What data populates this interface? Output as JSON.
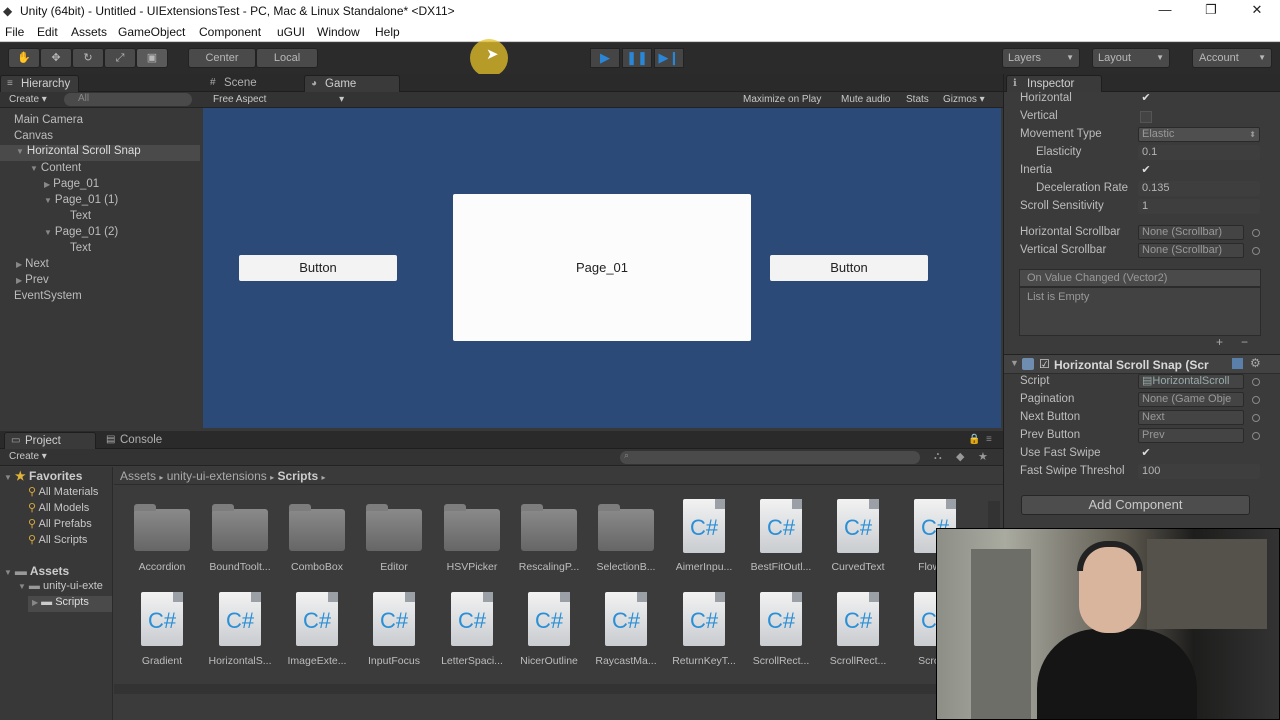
{
  "window": {
    "title": "Unity (64bit) - Untitled - UIExtensionsTest - PC, Mac & Linux Standalone* <DX11>"
  },
  "menu": [
    "File",
    "Edit",
    "Assets",
    "GameObject",
    "Component",
    "uGUI",
    "Window",
    "Help"
  ],
  "toolbar": {
    "pivot": "Center",
    "space": "Local",
    "layers": "Layers",
    "layout": "Layout",
    "account": "Account"
  },
  "hierarchy": {
    "tab": "Hierarchy",
    "create": "Create",
    "search_placeholder": "All",
    "items": [
      {
        "label": "Main Camera"
      },
      {
        "label": "Canvas"
      },
      {
        "label": "Horizontal Scroll Snap"
      },
      {
        "label": "Content"
      },
      {
        "label": "Page_01"
      },
      {
        "label": "Page_01 (1)"
      },
      {
        "label": "Text"
      },
      {
        "label": "Page_01 (2)"
      },
      {
        "label": "Text"
      },
      {
        "label": "Next"
      },
      {
        "label": "Prev"
      },
      {
        "label": "EventSystem"
      }
    ]
  },
  "scene": {
    "tab_scene": "Scene",
    "tab_game": "Game",
    "aspect": "Free Aspect",
    "options": [
      "Maximize on Play",
      "Mute audio",
      "Stats",
      "Gizmos"
    ],
    "left_button": "Button",
    "page_label": "Page_01",
    "right_button": "Button"
  },
  "inspector": {
    "tab": "Inspector",
    "scroll_rect": {
      "horizontal_label": "Horizontal",
      "vertical_label": "Vertical",
      "movement_label": "Movement Type",
      "movement_value": "Elastic",
      "elasticity_label": "Elasticity",
      "elasticity_value": "0.1",
      "inertia_label": "Inertia",
      "decel_label": "Deceleration Rate",
      "decel_value": "0.135",
      "sensitivity_label": "Scroll Sensitivity",
      "sensitivity_value": "1",
      "hscroll_label": "Horizontal Scrollbar",
      "hscroll_value": "None (Scrollbar)",
      "vscroll_label": "Vertical Scrollbar",
      "vscroll_value": "None (Scrollbar)",
      "event_label": "On Value Changed (Vector2)",
      "event_empty": "List is Empty"
    },
    "hss": {
      "title": "Horizontal Scroll Snap (Scr",
      "script_label": "Script",
      "script_value": "HorizontalScroll",
      "pagination_label": "Pagination",
      "pagination_value": "None (Game Obje",
      "next_label": "Next Button",
      "next_value": "Next",
      "prev_label": "Prev Button",
      "prev_value": "Prev",
      "fastswipe_label": "Use Fast Swipe",
      "threshold_label": "Fast Swipe Threshol",
      "threshold_value": "100"
    },
    "add_component": "Add Component"
  },
  "project": {
    "tab_project": "Project",
    "tab_console": "Console",
    "create": "Create",
    "favorites_title": "Favorites",
    "favorites": [
      "All Materials",
      "All Models",
      "All Prefabs",
      "All Scripts"
    ],
    "assets_title": "Assets",
    "tree": [
      "unity-ui-exte",
      "Scripts"
    ],
    "breadcrumb": [
      "Assets",
      "unity-ui-extensions",
      "Scripts"
    ],
    "row1": [
      {
        "name": "Accordion",
        "kind": "folder"
      },
      {
        "name": "BoundToolt...",
        "kind": "folder"
      },
      {
        "name": "ComboBox",
        "kind": "folder"
      },
      {
        "name": "Editor",
        "kind": "folder"
      },
      {
        "name": "HSVPicker",
        "kind": "folder"
      },
      {
        "name": "RescalingP...",
        "kind": "folder"
      },
      {
        "name": "SelectionB...",
        "kind": "folder"
      },
      {
        "name": "AimerInpu...",
        "kind": "cs"
      },
      {
        "name": "BestFitOutl...",
        "kind": "cs"
      },
      {
        "name": "CurvedText",
        "kind": "cs"
      },
      {
        "name": "FlowLa",
        "kind": "cs"
      }
    ],
    "row2": [
      {
        "name": "Gradient",
        "kind": "cs"
      },
      {
        "name": "HorizontalS...",
        "kind": "cs"
      },
      {
        "name": "ImageExte...",
        "kind": "cs"
      },
      {
        "name": "InputFocus",
        "kind": "cs"
      },
      {
        "name": "LetterSpaci...",
        "kind": "cs"
      },
      {
        "name": "NicerOutline",
        "kind": "cs"
      },
      {
        "name": "RaycastMa...",
        "kind": "cs"
      },
      {
        "name": "ReturnKeyT...",
        "kind": "cs"
      },
      {
        "name": "ScrollRect...",
        "kind": "cs"
      },
      {
        "name": "ScrollRect...",
        "kind": "cs"
      },
      {
        "name": "ScrollR",
        "kind": "cs"
      }
    ],
    "cs_glyph": "C#"
  },
  "colors": {
    "game_bg": "#2c4a77",
    "play_accent": "#2a87d8",
    "cursor_highlight": "#e6c229"
  }
}
